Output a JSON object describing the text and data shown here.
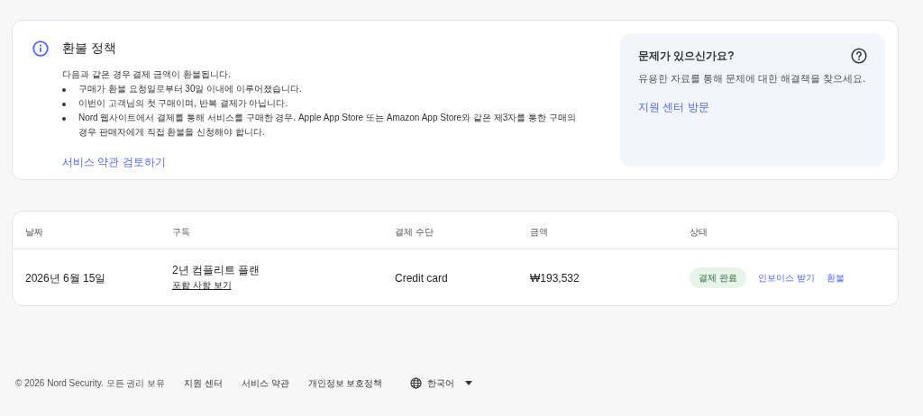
{
  "refund_policy": {
    "title": "환불 정책",
    "intro": "다음과 같은 경우 결제 금액이 환불됩니다.",
    "conditions": [
      "구매가 환불 요청일로부터 30일 이내에 이루어졌습니다.",
      "이번이 고객님의 첫 구매이며, 반복 결제가 아닙니다.",
      "Nord 웹사이트에서 결제를 통해 서비스를 구매한 경우. Apple App Store 또는 Amazon App Store와 같은 제3자를 통한 구매의 경우 판매자에게 직접 환불을 신청해야 합니다."
    ],
    "link": "서비스 약관 검토하기"
  },
  "help_panel": {
    "title": "문제가 있으신가요?",
    "text": "유용한 자료를 통해 문제에 대한 해결책을 찾으세요.",
    "link": "지원 센터 방문"
  },
  "table": {
    "columns": [
      "날짜",
      "구독",
      "결제 수단",
      "금액",
      "상태"
    ],
    "rows": [
      {
        "date": "2026년 6월 15일",
        "plan": "2년 컴플리트 플랜",
        "plan_link": "포함 사항 보기",
        "method": "Credit card",
        "amount": "₩193,532",
        "status": "결제 완료",
        "actions": [
          "인보이스 받기",
          "환불"
        ]
      }
    ]
  },
  "footer": {
    "copyright": "© 2026 Nord Security. 모든 권리 보유",
    "links": [
      "지원 센터",
      "서비스 약관",
      "개인정보 보호정책"
    ],
    "language": "한국어"
  }
}
